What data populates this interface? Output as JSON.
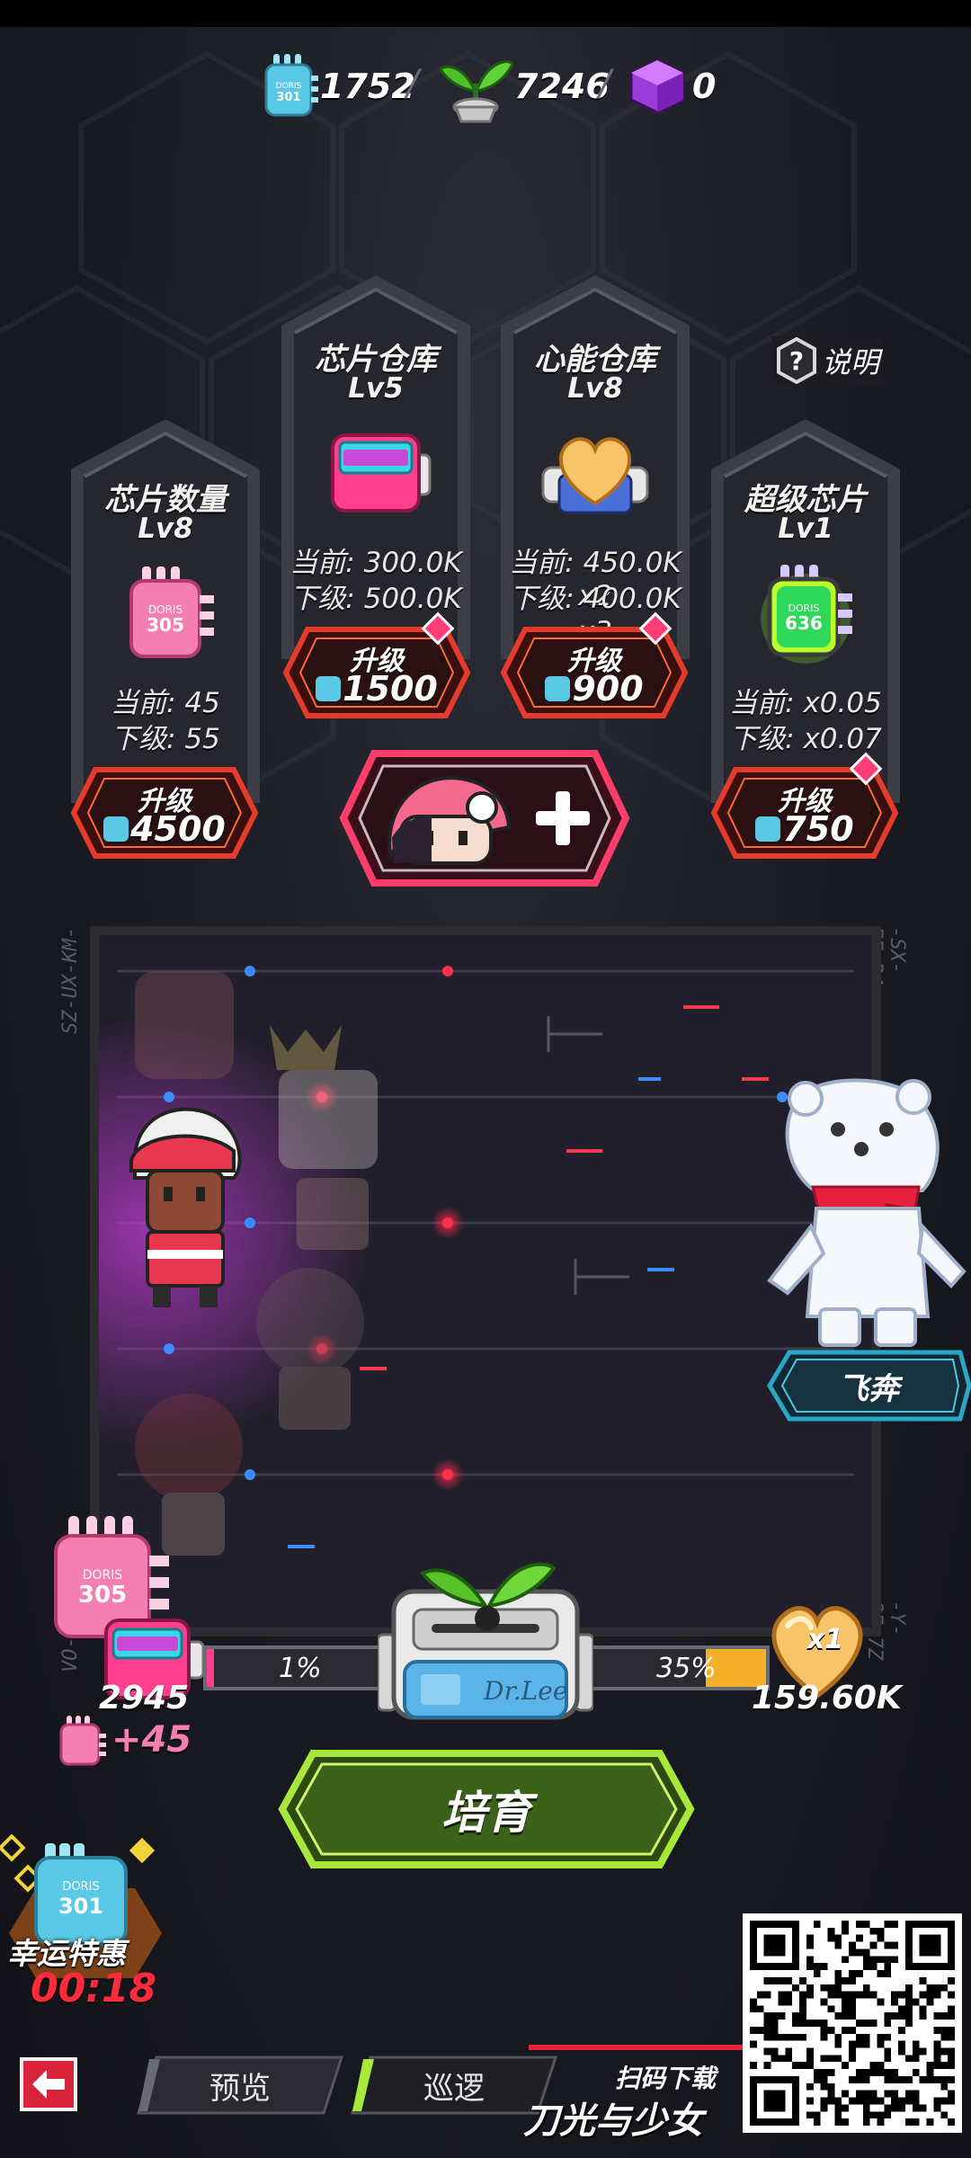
{
  "currencies": [
    {
      "name": "chip",
      "value": "1752",
      "icon": "chip-icon",
      "color": "#5ac9e6"
    },
    {
      "name": "sprout",
      "value": "7246",
      "icon": "sprout-icon",
      "color": "#4fbf2a"
    },
    {
      "name": "cube",
      "value": "0",
      "icon": "cube-icon",
      "color": "#b24cf0"
    }
  ],
  "help_label": "说明",
  "cards": [
    {
      "title": "芯片数量",
      "level": "Lv8",
      "current": "当前: 45",
      "next": "下级: 55",
      "button": "升级",
      "cost": "4500",
      "icon": "pink-chip-icon",
      "icon_text": "305"
    },
    {
      "title": "芯片仓库",
      "level": "Lv5",
      "current": "当前: 300.0K",
      "next": "下级: 500.0K",
      "button": "升级",
      "cost": "1500",
      "icon": "storage-box-icon"
    },
    {
      "title": "心能仓库",
      "level": "Lv8",
      "current": "当前: 450.0K x2",
      "next": "下级: 400.0K x3",
      "button": "升级",
      "cost": "900",
      "icon": "heart-tank-icon"
    },
    {
      "title": "超级芯片",
      "level": "Lv1",
      "current": "当前: x0.05",
      "next": "下级: x0.07",
      "button": "升级",
      "cost": "750",
      "icon": "green-chip-icon",
      "icon_text": "636"
    }
  ],
  "side_codes": {
    "left_top": "SZ-UX-KM-",
    "right_top": "-SX-FF-R4",
    "left_bottom": "VO-PQ-3",
    "right_bottom": "-Y-OF-7Z"
  },
  "fly_button": "飞奔",
  "pink_chip_number": "305",
  "chip_count": "2945",
  "chip_gain": "+45",
  "left_progress": "1%",
  "right_progress": "35%",
  "left_progress_value": 0.01,
  "right_progress_value": 0.35,
  "heart_multiplier": "x1",
  "heart_amount": "159.60K",
  "device_label": "Dr.Lee",
  "grow_button": "培育",
  "lucky_label": "幸运特惠",
  "lucky_timer": "00:18",
  "lucky_chip_number": "301",
  "tabs": [
    "预览",
    "巡逻"
  ],
  "scan_label": "扫码下载",
  "game_logo": "刀光与少女",
  "colors": {
    "accent_red": "#ff3b3b",
    "accent_green": "#a8e83a",
    "chip_blue": "#5ac9e6",
    "chip_pink": "#f47fb0"
  }
}
